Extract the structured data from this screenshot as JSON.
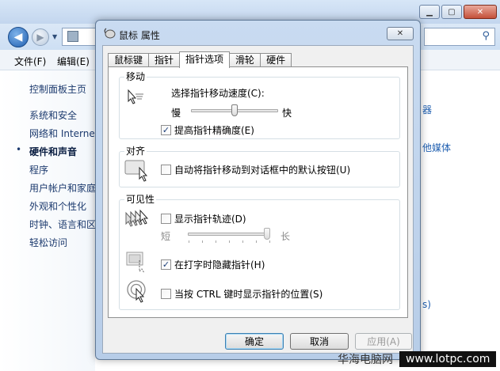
{
  "background_window": {
    "menu": [
      "文件(F)",
      "编辑(E)"
    ],
    "sidebar": {
      "home": "控制面板主页",
      "items": [
        "系统和安全",
        "网络和 Internet",
        "硬件和声音",
        "程序",
        "用户帐户和家庭安全",
        "外观和个性化",
        "时钟、语言和区域",
        "轻松访问"
      ],
      "current_index": 2
    },
    "right_fragments": [
      "器",
      "他媒体",
      "s)"
    ]
  },
  "dialog": {
    "title": "鼠标 属性",
    "tabs": [
      "鼠标键",
      "指针",
      "指针选项",
      "滑轮",
      "硬件"
    ],
    "active_tab": "指针选项",
    "motion": {
      "group_label": "移动",
      "speed_label": "选择指针移动速度(C):",
      "slow": "慢",
      "fast": "快",
      "speed_value_fraction": 0.5,
      "precision_label": "提高指针精确度(E)",
      "precision_checked": true
    },
    "snap": {
      "group_label": "对齐",
      "label": "自动将指针移动到对话框中的默认按钮(U)",
      "checked": false
    },
    "visibility": {
      "group_label": "可见性",
      "trails_label": "显示指针轨迹(D)",
      "trails_checked": false,
      "short": "短",
      "long": "长",
      "trail_value_fraction": 1.0,
      "hide_label": "在打字时隐藏指针(H)",
      "hide_checked": true,
      "ctrl_label": "当按 CTRL 键时显示指针的位置(S)",
      "ctrl_checked": false
    },
    "buttons": {
      "ok": "确定",
      "cancel": "取消",
      "apply": "应用(A)"
    }
  },
  "watermark": {
    "cn": "华海电脑网",
    "url": "www.lotpc.com"
  }
}
